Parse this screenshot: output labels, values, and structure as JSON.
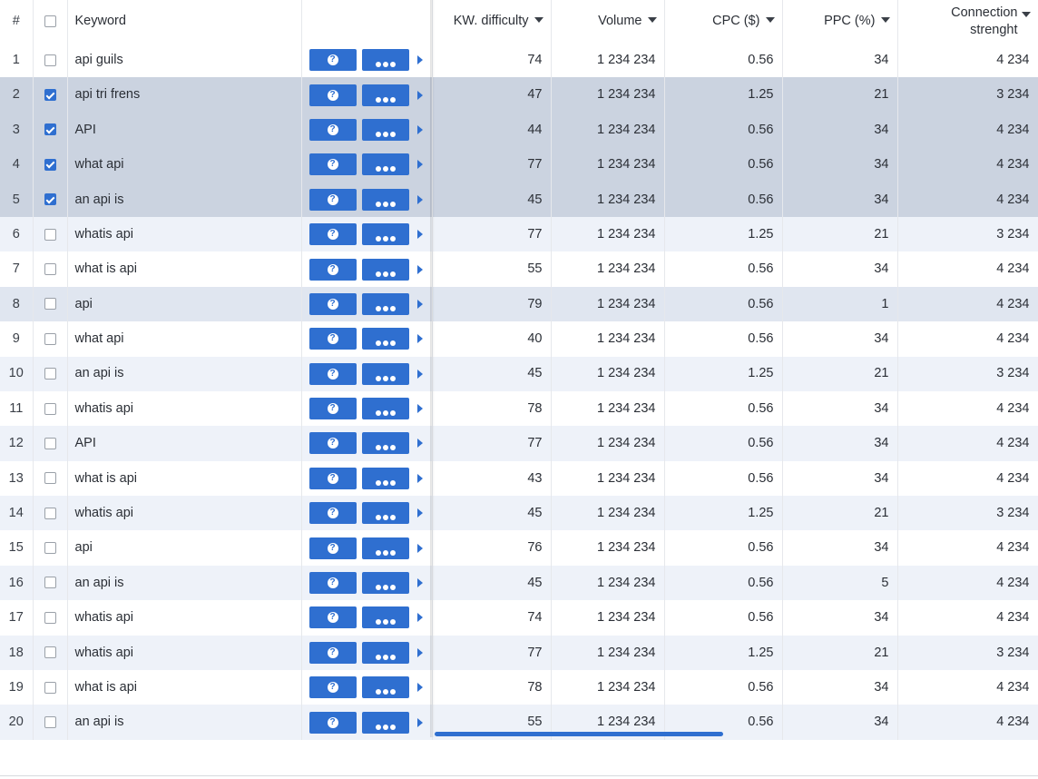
{
  "header": {
    "num": "#",
    "keyword": "Keyword",
    "kw_difficulty": "KW. difficulty",
    "volume": "Volume",
    "cpc": "CPC ($)",
    "ppc": "PPC (%)",
    "connection_l1": "Connection",
    "connection_l2": "strenght"
  },
  "actions": {
    "help_glyph": "?",
    "more_icon": "more-dots-icon"
  },
  "colors": {
    "accent": "#2f6fd0",
    "row_alt": "#eef2f9",
    "row_selected": "#cbd3e0",
    "row_hover": "#e0e6f0"
  },
  "rows": [
    {
      "n": "1",
      "checked": false,
      "keyword": "api guils",
      "kd": "74",
      "volume": "1 234 234",
      "cpc": "0.56",
      "ppc": "34",
      "conn": "4 234"
    },
    {
      "n": "2",
      "checked": true,
      "keyword": "api tri frens",
      "kd": "47",
      "volume": "1 234 234",
      "cpc": "1.25",
      "ppc": "21",
      "conn": "3 234"
    },
    {
      "n": "3",
      "checked": true,
      "keyword": "API",
      "kd": "44",
      "volume": "1 234 234",
      "cpc": "0.56",
      "ppc": "34",
      "conn": "4 234"
    },
    {
      "n": "4",
      "checked": true,
      "keyword": "what api",
      "kd": "77",
      "volume": "1 234 234",
      "cpc": "0.56",
      "ppc": "34",
      "conn": "4 234"
    },
    {
      "n": "5",
      "checked": true,
      "keyword": "an api is",
      "kd": "45",
      "volume": "1 234 234",
      "cpc": "0.56",
      "ppc": "34",
      "conn": "4 234"
    },
    {
      "n": "6",
      "checked": false,
      "keyword": "whatis api",
      "kd": "77",
      "volume": "1 234 234",
      "cpc": "1.25",
      "ppc": "21",
      "conn": "3 234"
    },
    {
      "n": "7",
      "checked": false,
      "keyword": "what is api",
      "kd": "55",
      "volume": "1 234 234",
      "cpc": "0.56",
      "ppc": "34",
      "conn": "4 234"
    },
    {
      "n": "8",
      "checked": false,
      "keyword": "api",
      "kd": "79",
      "volume": "1 234 234",
      "cpc": "0.56",
      "ppc": "1",
      "conn": "4 234"
    },
    {
      "n": "9",
      "checked": false,
      "keyword": "what api",
      "kd": "40",
      "volume": "1 234 234",
      "cpc": "0.56",
      "ppc": "34",
      "conn": "4 234"
    },
    {
      "n": "10",
      "checked": false,
      "keyword": "an api is",
      "kd": "45",
      "volume": "1 234 234",
      "cpc": "1.25",
      "ppc": "21",
      "conn": "3 234"
    },
    {
      "n": "11",
      "checked": false,
      "keyword": "whatis api",
      "kd": "78",
      "volume": "1 234 234",
      "cpc": "0.56",
      "ppc": "34",
      "conn": "4 234"
    },
    {
      "n": "12",
      "checked": false,
      "keyword": "API",
      "kd": "77",
      "volume": "1 234 234",
      "cpc": "0.56",
      "ppc": "34",
      "conn": "4 234"
    },
    {
      "n": "13",
      "checked": false,
      "keyword": "what is api",
      "kd": "43",
      "volume": "1 234 234",
      "cpc": "0.56",
      "ppc": "34",
      "conn": "4 234"
    },
    {
      "n": "14",
      "checked": false,
      "keyword": "whatis api",
      "kd": "45",
      "volume": "1 234 234",
      "cpc": "1.25",
      "ppc": "21",
      "conn": "3 234"
    },
    {
      "n": "15",
      "checked": false,
      "keyword": "api",
      "kd": "76",
      "volume": "1 234 234",
      "cpc": "0.56",
      "ppc": "34",
      "conn": "4 234"
    },
    {
      "n": "16",
      "checked": false,
      "keyword": "an api is",
      "kd": "45",
      "volume": "1 234 234",
      "cpc": "0.56",
      "ppc": "5",
      "conn": "4 234"
    },
    {
      "n": "17",
      "checked": false,
      "keyword": "whatis api",
      "kd": "74",
      "volume": "1 234 234",
      "cpc": "0.56",
      "ppc": "34",
      "conn": "4 234"
    },
    {
      "n": "18",
      "checked": false,
      "keyword": "whatis api",
      "kd": "77",
      "volume": "1 234 234",
      "cpc": "1.25",
      "ppc": "21",
      "conn": "3 234"
    },
    {
      "n": "19",
      "checked": false,
      "keyword": "what is api",
      "kd": "78",
      "volume": "1 234 234",
      "cpc": "0.56",
      "ppc": "34",
      "conn": "4 234"
    },
    {
      "n": "20",
      "checked": false,
      "keyword": "an api is",
      "kd": "55",
      "volume": "1 234 234",
      "cpc": "0.56",
      "ppc": "34",
      "conn": "4 234"
    }
  ]
}
